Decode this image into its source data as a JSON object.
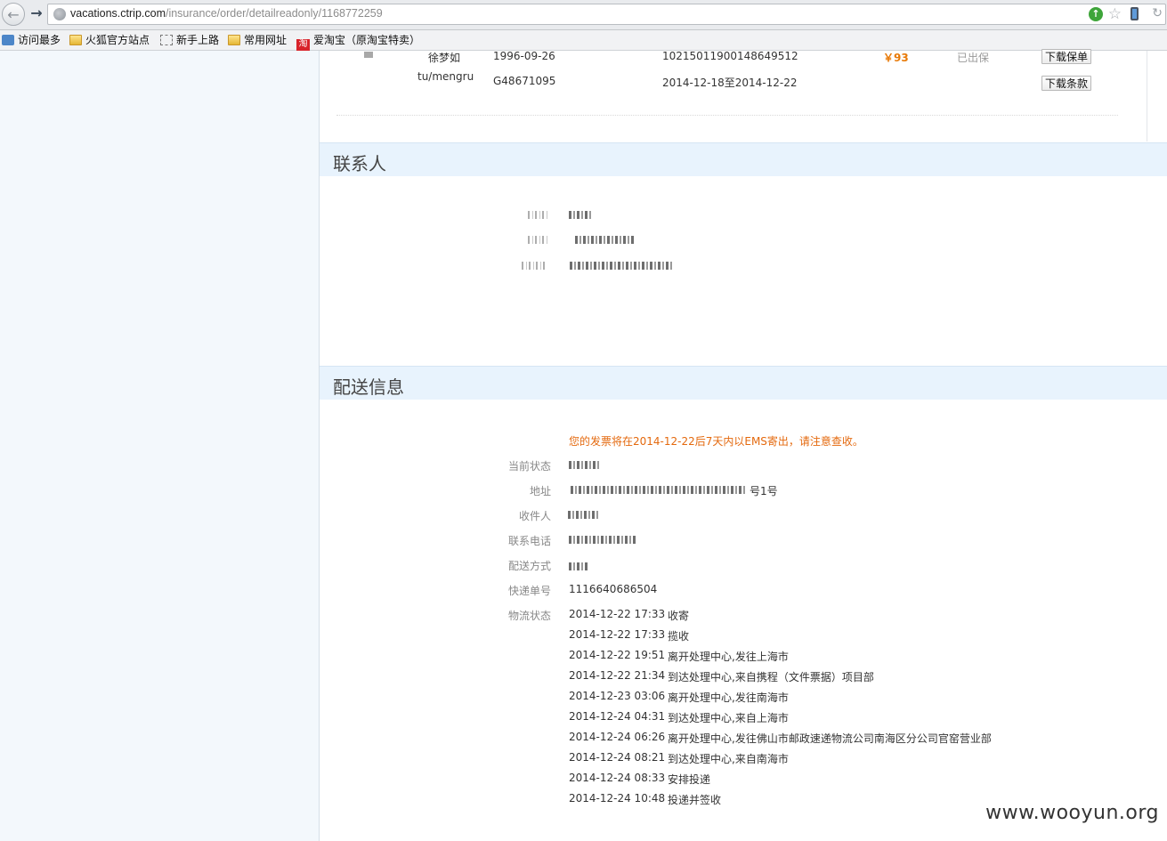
{
  "browser": {
    "url_host": "vacations.ctrip.com",
    "url_path": "/insurance/order/detailreadonly/1168772259",
    "bookmarks": [
      {
        "label": "访问最多",
        "icon": "search-icon"
      },
      {
        "label": "火狐官方站点",
        "icon": "folder-icon"
      },
      {
        "label": "新手上路",
        "icon": "bookmark-icon"
      },
      {
        "label": "常用网址",
        "icon": "folder-icon"
      },
      {
        "label": "爱淘宝（原淘宝特卖）",
        "icon": "taobao-icon",
        "icon_text": "淘"
      }
    ]
  },
  "insured_row": {
    "name": "徐梦如",
    "pinyin": "tu/mengru",
    "birthdate": "1996-09-26",
    "passport": "G48671095",
    "policy_no": "10215011900148649512",
    "period": "2014-12-18至2014-12-22",
    "price": "￥93",
    "status": "已出保",
    "download_policy_label": "下载保单",
    "download_terms_label": "下载条款"
  },
  "contact": {
    "title": "联系人"
  },
  "delivery": {
    "title": "配送信息",
    "notice": "您的发票将在2014-12-22后7天内以EMS寄出，请注意查收。",
    "labels": {
      "status": "当前状态",
      "address": "地址",
      "recipient": "收件人",
      "phone": "联系电话",
      "method": "配送方式",
      "tracking": "快递单号",
      "logistics": "物流状态"
    },
    "address_suffix": "号1号",
    "tracking_no": "1116640686504",
    "logistics": [
      {
        "time": "2014-12-22 17:33",
        "desc": "收寄"
      },
      {
        "time": "2014-12-22 17:33",
        "desc": "揽收"
      },
      {
        "time": "2014-12-22 19:51",
        "desc": "离开处理中心,发往上海市"
      },
      {
        "time": "2014-12-22 21:34",
        "desc": "到达处理中心,来自携程（文件票据）项目部"
      },
      {
        "time": "2014-12-23 03:06",
        "desc": "离开处理中心,发往南海市"
      },
      {
        "time": "2014-12-24 04:31",
        "desc": "到达处理中心,来自上海市"
      },
      {
        "time": "2014-12-24 06:26",
        "desc": "离开处理中心,发往佛山市邮政速递物流公司南海区分公司官窑营业部"
      },
      {
        "time": "2014-12-24 08:21",
        "desc": "到达处理中心,来自南海市"
      },
      {
        "time": "2014-12-24 08:33",
        "desc": "安排投递"
      },
      {
        "time": "2014-12-24 10:48",
        "desc": "投递并签收"
      }
    ]
  },
  "watermark": "www.wooyun.org",
  "colors": {
    "accent_orange": "#e4690e",
    "section_bg": "#e8f3fd",
    "left_panel": "#f3f8fc"
  }
}
